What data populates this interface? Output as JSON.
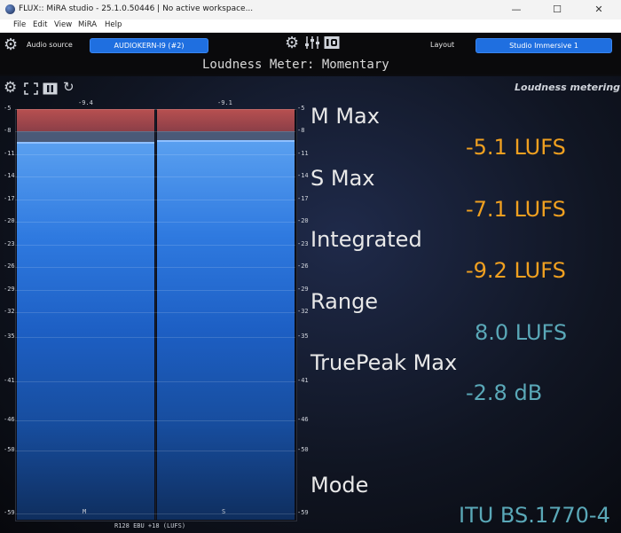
{
  "window": {
    "title": "FLUX:: MiRA studio - 25.1.0.50446 | No active workspace...",
    "minimize": "—",
    "maximize": "☐",
    "close": "✕"
  },
  "menu": [
    "File",
    "Edit",
    "View",
    "MiRA",
    "Help"
  ],
  "toolbar": {
    "audio_source_label": "Audio source",
    "audio_source_value": "AUDIOKERN-I9 (#2)",
    "layout_label": "Layout",
    "layout_value": "Studio Immersive 1",
    "view_title": "Loudness Meter: Momentary"
  },
  "panel": {
    "header": "Loudness metering",
    "footer_label": "R128 EBU +18 (LUFS)"
  },
  "meter": {
    "channels": [
      {
        "label": "M",
        "peak_text": "-9.4",
        "peak": -9.4
      },
      {
        "label": "S",
        "peak_text": "-9.1",
        "peak": -9.1
      }
    ],
    "ticks": [
      "-5",
      "-8",
      "-11",
      "-14",
      "-17",
      "-20",
      "-23",
      "-26",
      "-29",
      "-32",
      "-35",
      "-41",
      "-46",
      "-50",
      "-59"
    ]
  },
  "readouts": {
    "m_max_label": "M Max",
    "m_max_value": "-5.1 LUFS",
    "s_max_label": "S Max",
    "s_max_value": "-7.1 LUFS",
    "integrated_label": "Integrated",
    "integrated_value": "-9.2 LUFS",
    "range_label": "Range",
    "range_value": "8.0 LUFS",
    "truepeak_label": "TruePeak Max",
    "truepeak_value": "-2.8 dB",
    "mode_label": "Mode",
    "mode_value": "ITU BS.1770-4"
  },
  "colors": {
    "accent_blue": "#1f6fe0",
    "value_orange": "#f0a020",
    "value_teal": "#5aa8b8",
    "meter_red": "#c05050"
  }
}
